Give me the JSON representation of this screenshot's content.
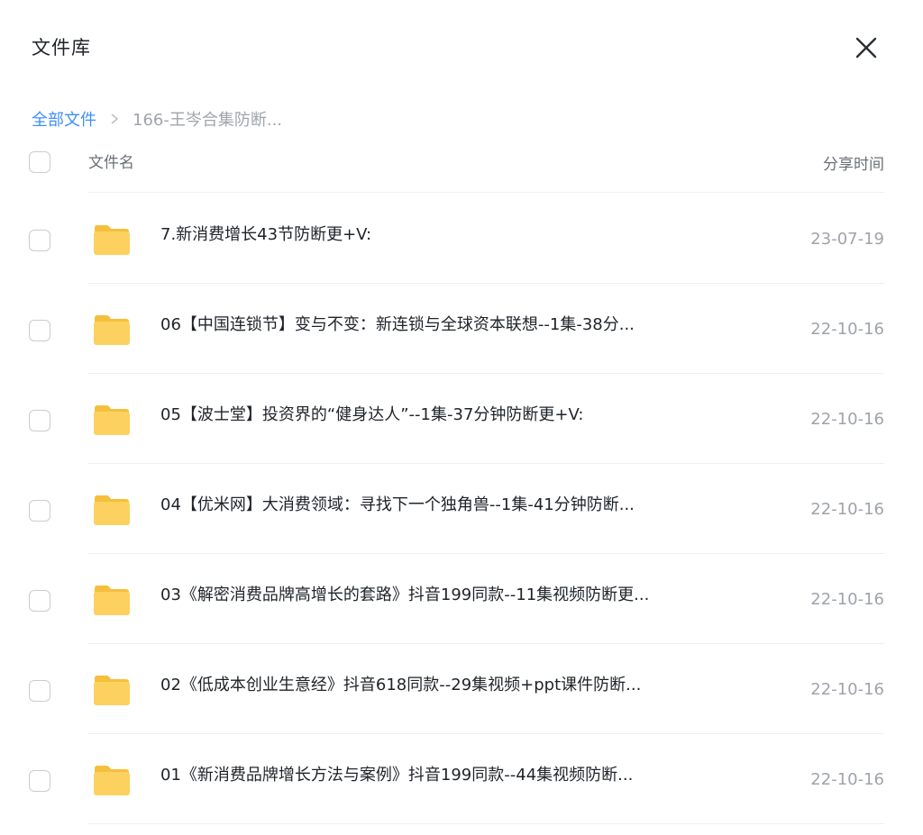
{
  "dialog": {
    "title": "文件库",
    "close_icon": "close-icon"
  },
  "breadcrumb": {
    "root": "全部文件",
    "current": "166-王岑合集防断..."
  },
  "table": {
    "columns": {
      "name": "文件名",
      "time": "分享时间"
    },
    "rows": [
      {
        "name": "7.新消费增长43节防断更+V:",
        "date": "23-07-19",
        "icon": "folder-icon"
      },
      {
        "name": "06【中国连锁节】变与不变：新连锁与全球资本联想--1集-38分...",
        "date": "22-10-16",
        "icon": "folder-icon"
      },
      {
        "name": "05【波士堂】投资界的“健身达人”--1集-37分钟防断更+V:",
        "date": "22-10-16",
        "icon": "folder-icon"
      },
      {
        "name": "04【优米网】大消费领域：寻找下一个独角兽--1集-41分钟防断...",
        "date": "22-10-16",
        "icon": "folder-icon"
      },
      {
        "name": "03《解密消费品牌高增长的套路》抖音199同款--11集视频防断更...",
        "date": "22-10-16",
        "icon": "folder-icon"
      },
      {
        "name": "02《低成本创业生意经》抖音618同款--29集视频+ppt课件防断...",
        "date": "22-10-16",
        "icon": "folder-icon"
      },
      {
        "name": "01《新消费品牌增长方法与案例》抖音199同款--44集视频防断...",
        "date": "22-10-16",
        "icon": "folder-icon"
      }
    ]
  },
  "colors": {
    "accent": "#3f8ff7",
    "folder": "#fcd15f"
  }
}
